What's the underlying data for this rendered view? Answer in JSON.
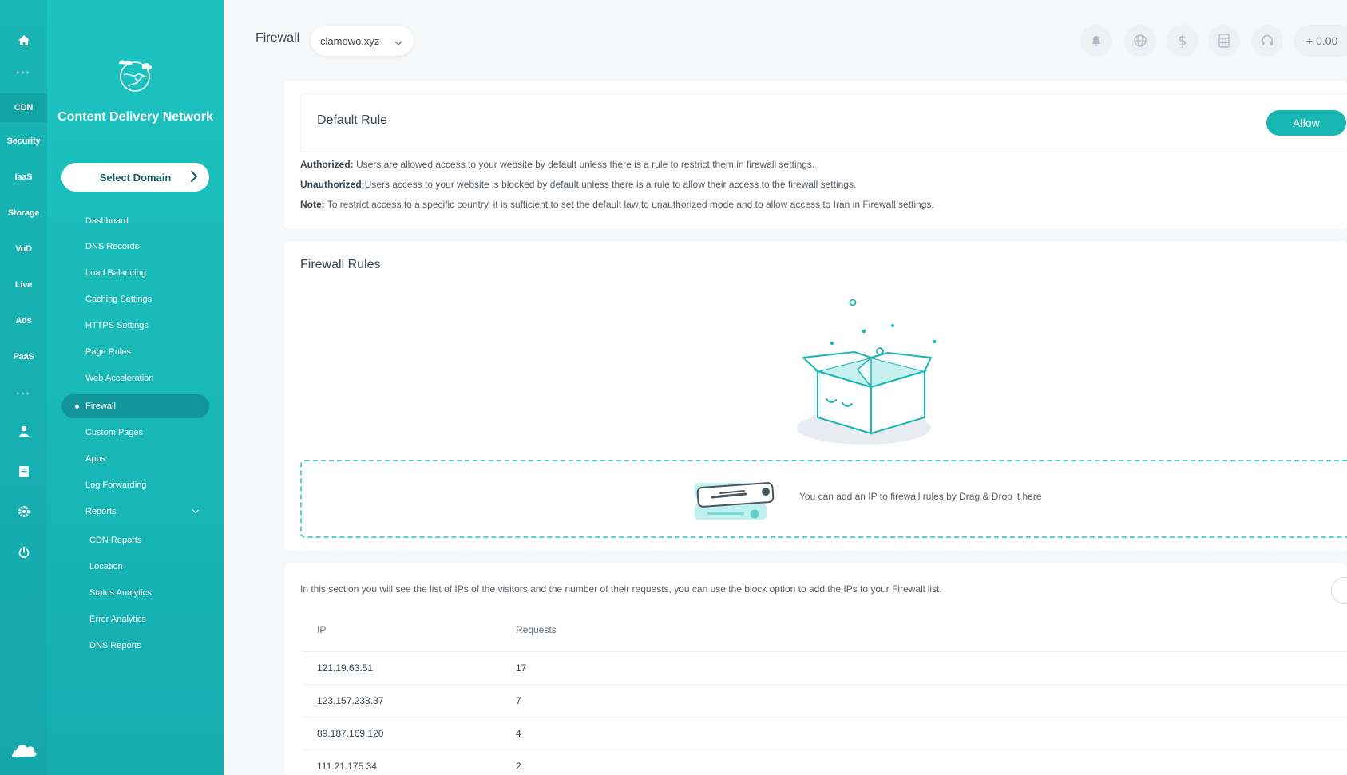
{
  "rail": {
    "items": [
      "CDN",
      "Security",
      "IaaS",
      "Storage",
      "VoD",
      "Live",
      "Ads",
      "PaaS"
    ],
    "active": "CDN"
  },
  "sidebar": {
    "title": "Content Delivery Network",
    "select_domain": "Select Domain",
    "nav": [
      "Dashboard",
      "DNS Records",
      "Load Balancing",
      "Caching Settings",
      "HTTPS Settings",
      "Page Rules",
      "Web Acceleration",
      "Firewall",
      "Custom Pages",
      "Apps",
      "Log Forwarding",
      "Reports"
    ],
    "active": "Firewall",
    "reports_sub": [
      "CDN Reports",
      "Location",
      "Status Analytics",
      "Error Analytics",
      "DNS Reports"
    ]
  },
  "header": {
    "title": "Firewall",
    "domain": "clamowo.xyz",
    "balance": "+ 0.00"
  },
  "default_rule": {
    "title": "Default Rule",
    "toggle_label": "Allow",
    "lines": [
      {
        "label": "Authorized:",
        "text": " Users are allowed access to your website by default unless there is a rule to restrict them in firewall settings."
      },
      {
        "label": "Unauthorized:",
        "text": "Users access to your website is blocked by default unless there is a rule to allow their access to the firewall settings."
      },
      {
        "label": "Note:",
        "text": " To restrict access to a specific country, it is sufficient to set the default law to unauthorized mode and to allow access to Iran in Firewall settings."
      }
    ]
  },
  "firewall_rules": {
    "title": "Firewall Rules",
    "drop_hint": "You can add an IP to firewall rules by Drag & Drop it here"
  },
  "ip_list": {
    "description": "In this section you will see the list of IPs of the visitors and the number of their requests, you can use the block option to add the IPs to your Firewall list.",
    "columns": [
      "IP",
      "Requests"
    ],
    "rows": [
      {
        "ip": "121.19.63.51",
        "requests": "17"
      },
      {
        "ip": "123.157.238.37",
        "requests": "7"
      },
      {
        "ip": "89.187.169.120",
        "requests": "4"
      },
      {
        "ip": "111.21.175.34",
        "requests": "2"
      }
    ]
  },
  "colors": {
    "brand": "#19b6b3",
    "sidebar_active": "#11959a"
  }
}
